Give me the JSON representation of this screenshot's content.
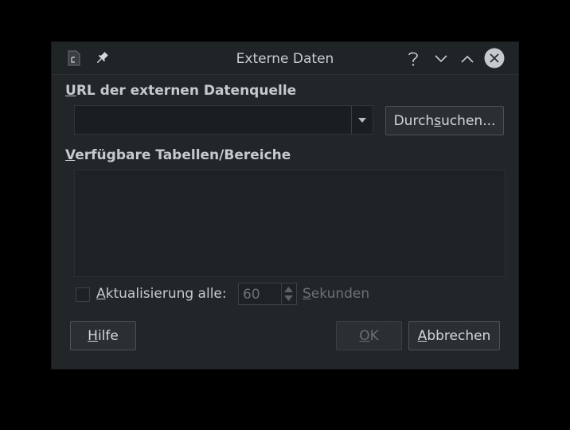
{
  "window": {
    "title": "Externe Daten"
  },
  "url_section": {
    "label_first": "U",
    "label_rest": "RL der externen Datenquelle",
    "url_value": "",
    "browse_pre": "Durch",
    "browse_mnemonic": "s",
    "browse_post": "uchen..."
  },
  "tables_section": {
    "label_first": "V",
    "label_rest": "erfügbare Tabellen/Bereiche",
    "items": []
  },
  "update": {
    "checked": false,
    "label_first": "A",
    "label_rest": "ktualisierung alle:",
    "interval_value": "60",
    "unit_first": "S",
    "unit_rest": "ekunden"
  },
  "buttons": {
    "help_first": "H",
    "help_rest": "ilfe",
    "ok_first": "O",
    "ok_rest": "K",
    "cancel_first": "A",
    "cancel_rest": "bbrechen"
  },
  "colors": {
    "background": "#000000",
    "dialog": "#232629",
    "titlebar": "#1f2427",
    "text": "#c6cacd",
    "disabled_text": "#6a6f73"
  }
}
